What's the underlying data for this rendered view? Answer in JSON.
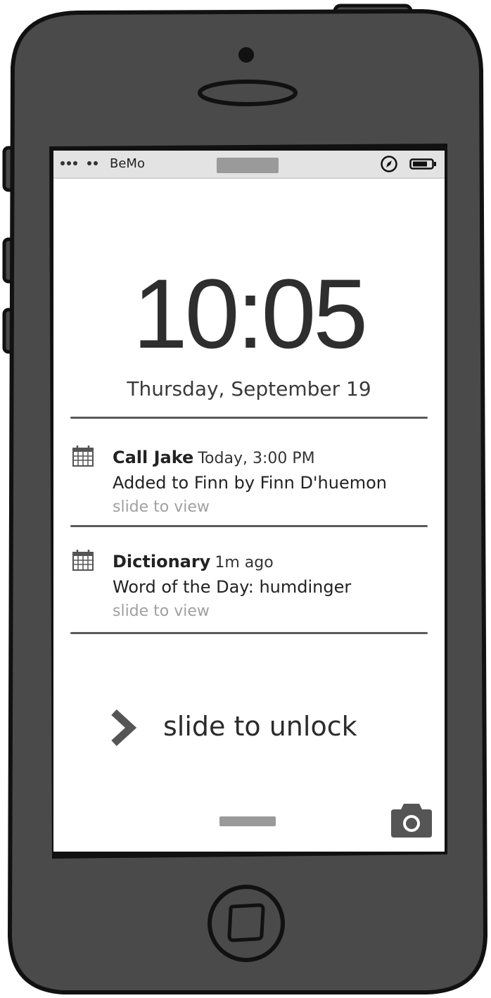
{
  "status_bar": {
    "carrier": "BeMo",
    "signal_icon": "signal-dots-icon",
    "location_icon": "compass-icon",
    "battery_icon": "battery-icon"
  },
  "lock_screen": {
    "time": "10:05",
    "date": "Thursday, September 19"
  },
  "notifications": [
    {
      "icon": "calendar-icon",
      "app": "Call Jake",
      "meta": "Today, 3:00 PM",
      "message": "Added to Finn by Finn D'huemon",
      "action": "slide to view"
    },
    {
      "icon": "calendar-icon",
      "app": "Dictionary",
      "meta": "1m ago",
      "message": "Word of the Day: humdinger",
      "action": "slide to view"
    }
  ],
  "unlock": {
    "label": "slide to unlock",
    "icon": "chevron-right-icon"
  },
  "camera": {
    "icon": "camera-icon"
  },
  "colors": {
    "phone_body": "#4a4a4a",
    "outline": "#111111",
    "screen": "#ffffff",
    "status_bar": "#e3e3e3",
    "muted_text": "#a0a0a0"
  }
}
